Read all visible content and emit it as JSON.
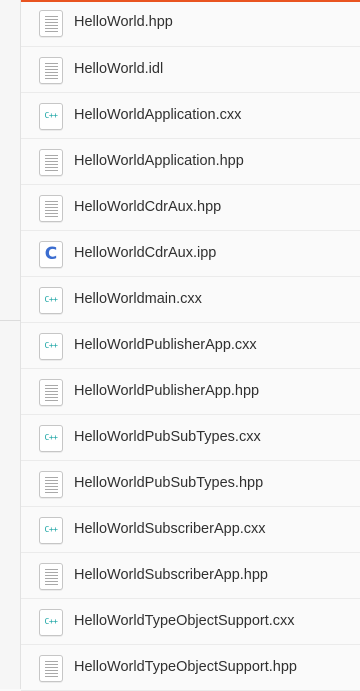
{
  "files": [
    {
      "name": "HelloWorld.hpp",
      "icon": "text-file-icon"
    },
    {
      "name": "HelloWorld.idl",
      "icon": "text-file-icon"
    },
    {
      "name": "HelloWorldApplication.cxx",
      "icon": "cpp-file-icon",
      "icon_label": "C++"
    },
    {
      "name": "HelloWorldApplication.hpp",
      "icon": "text-file-icon"
    },
    {
      "name": "HelloWorldCdrAux.hpp",
      "icon": "text-file-icon"
    },
    {
      "name": "HelloWorldCdrAux.ipp",
      "icon": "c-file-icon",
      "icon_label": "C"
    },
    {
      "name": "HelloWorldmain.cxx",
      "icon": "cpp-file-icon",
      "icon_label": "C++"
    },
    {
      "name": "HelloWorldPublisherApp.cxx",
      "icon": "cpp-file-icon",
      "icon_label": "C++"
    },
    {
      "name": "HelloWorldPublisherApp.hpp",
      "icon": "text-file-icon"
    },
    {
      "name": "HelloWorldPubSubTypes.cxx",
      "icon": "cpp-file-icon",
      "icon_label": "C++"
    },
    {
      "name": "HelloWorldPubSubTypes.hpp",
      "icon": "text-file-icon"
    },
    {
      "name": "HelloWorldSubscriberApp.cxx",
      "icon": "cpp-file-icon",
      "icon_label": "C++"
    },
    {
      "name": "HelloWorldSubscriberApp.hpp",
      "icon": "text-file-icon"
    },
    {
      "name": "HelloWorldTypeObjectSupport.cxx",
      "icon": "cpp-file-icon",
      "icon_label": "C++"
    },
    {
      "name": "HelloWorldTypeObjectSupport.hpp",
      "icon": "text-file-icon"
    }
  ],
  "colors": {
    "accent": "#e95420",
    "cpp_icon": "#16a3a3",
    "c_icon": "#3b6dd0"
  }
}
